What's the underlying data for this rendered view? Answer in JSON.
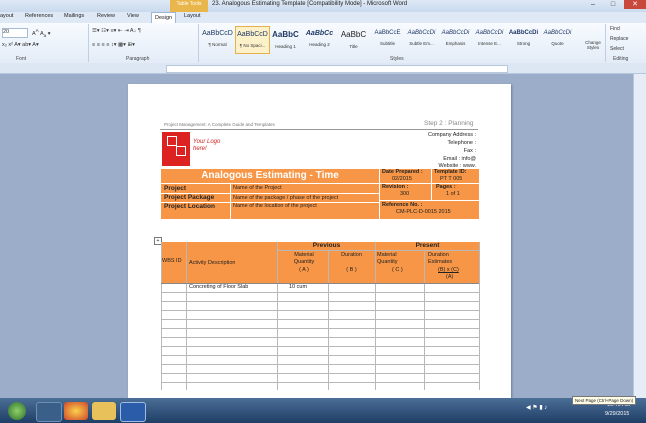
{
  "titlebar": {
    "context_tab": "Table Tools",
    "title": "23. Analogous Estimating  Template [Compatibility Mode] - Microsoft Word",
    "min": "–",
    "max": "□",
    "close": "✕"
  },
  "tabs": [
    "ayout",
    "References",
    "Mailings",
    "Review",
    "View",
    "Design",
    "Layout"
  ],
  "ribbon": {
    "font_size": "20",
    "font_group": "Font",
    "paragraph_group": "Paragraph",
    "styles_group": "Styles",
    "editing_group": "Editing",
    "styles": [
      {
        "preview": "AaBbCcD",
        "name": "¶ Normal"
      },
      {
        "preview": "AaBbCcD",
        "name": "¶ No Spaci..."
      },
      {
        "preview": "AaBbC",
        "name": "Heading 1"
      },
      {
        "preview": "AaBbCc",
        "name": "Heading 2"
      },
      {
        "preview": "AaBbC",
        "name": "Title"
      },
      {
        "preview": "AaBbCcE",
        "name": "Subtitle"
      },
      {
        "preview": "AaBbCcDi",
        "name": "Subtle Em..."
      },
      {
        "preview": "AaBbCcDi",
        "name": "Emphasis"
      },
      {
        "preview": "AaBbCcDi",
        "name": "Intense E..."
      },
      {
        "preview": "AaBbCcDi",
        "name": "Strong"
      },
      {
        "preview": "AaBbCcDi",
        "name": "Quote"
      }
    ],
    "change_styles": "Change Styles",
    "find": "Find",
    "replace": "Replace",
    "select": "Select"
  },
  "document": {
    "header_left": "Project Management: A Complete Guide and Templates",
    "header_right": "Step 2 : Planning",
    "company": {
      "address": "Company Address :",
      "telephone": "Telephone :",
      "fax": "Fax :",
      "email": "Email : info@",
      "website": "Website : www."
    },
    "logo_text": "Your Logo here!",
    "form_title": "Analogous Estimating - Time",
    "date_prepared_label": "Date Prepared :",
    "date_prepared_value": "02/2015",
    "template_id_label": "Template ID:",
    "template_id_value": "PT T 005",
    "revision_label": "Revision :",
    "revision_value": "300",
    "pages_label": "Pages :",
    "pages_value": "1 of 1",
    "reference_label": "Reference No. :",
    "reference_value": "CM-PLC-D-0015 2015",
    "project_label": "Project",
    "project_value": "Name of the Project",
    "package_label": "Project  Package",
    "package_value": "Name of the package / phase of the project",
    "location_label": "Project Location",
    "location_value": "Name of the location of the project",
    "table": {
      "previous": "Previous",
      "present": "Present",
      "wbs": "WBS ID",
      "activity": "Activity Description",
      "material_qty": "Material Quantity",
      "a": "( A )",
      "duration": "Duration",
      "b": "( B )",
      "material_qty2": "Material Quantity",
      "c": "( C )",
      "duration_est": "Duration Estimates",
      "bxc": "(B) x (C)",
      "a2": "(A)",
      "row1_activity": "Concreting of Floor Slab",
      "row1_qty": "10  cum"
    }
  },
  "tooltip": "Next Page (Ctrl+Page Down)",
  "clock": {
    "time": "10:40 AM",
    "date": "9/29/2015"
  }
}
